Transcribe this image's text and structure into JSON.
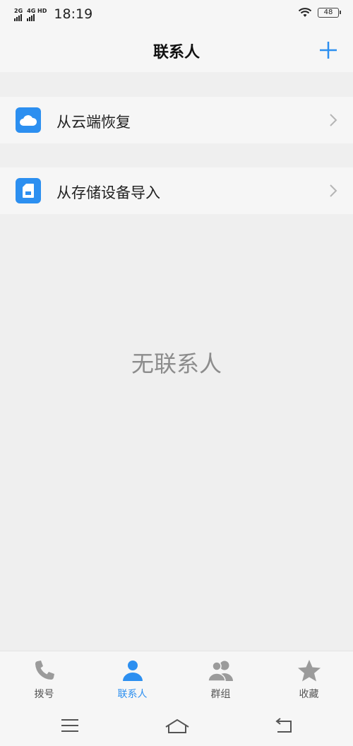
{
  "status_bar": {
    "sim1": "2G",
    "sim2": "4G HD",
    "time": "18:19",
    "battery": "48"
  },
  "header": {
    "title": "联系人",
    "add_icon": "plus-icon"
  },
  "rows": [
    {
      "label": "从云端恢复",
      "icon": "cloud-icon"
    },
    {
      "label": "从存储设备导入",
      "icon": "sd-card-icon"
    }
  ],
  "empty_state": "无联系人",
  "tabs": [
    {
      "label": "拨号",
      "icon": "phone-icon",
      "active": false
    },
    {
      "label": "联系人",
      "icon": "person-icon",
      "active": true
    },
    {
      "label": "群组",
      "icon": "group-icon",
      "active": false
    },
    {
      "label": "收藏",
      "icon": "star-icon",
      "active": false
    }
  ],
  "colors": {
    "accent": "#2c8ff0",
    "background": "#efefef",
    "surface": "#f6f6f6",
    "muted_text": "#8c8c8c"
  }
}
